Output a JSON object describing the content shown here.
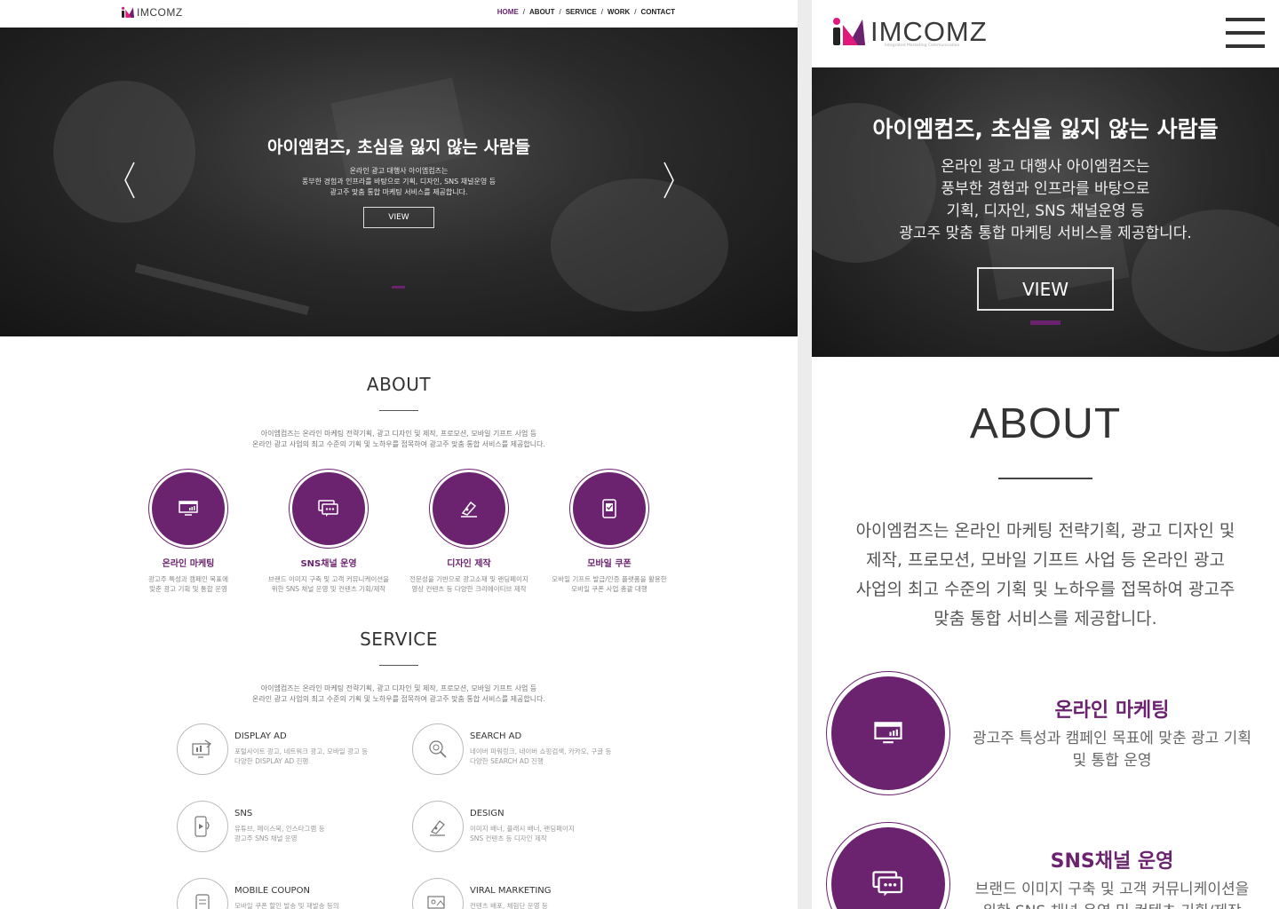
{
  "brand": {
    "name": "IMCOMZ",
    "tagline": "Integrated Marketing Communication",
    "accent": "#6b2370",
    "mark_colors": [
      "#222222",
      "#e0197d",
      "#6b2370"
    ]
  },
  "nav": {
    "items": [
      "HOME",
      "ABOUT",
      "SERVICE",
      "WORK",
      "CONTACT"
    ],
    "separator": "/",
    "active": "HOME"
  },
  "hero": {
    "title": "아이엠컴즈, 초심을 잃지 않는 사람들",
    "desktop_desc": [
      "온라인 광고 대행사 아이엠컴즈는",
      "풍부한 경험과 인프라를 바탕으로 기획, 디자인, SNS 채널운영 등",
      "광고주 맞춤 통합 마케팅 서비스를 제공합니다."
    ],
    "mobile_desc": [
      "온라인 광고 대행사 아이엠컴즈는",
      "풍부한 경험과 인프라를 바탕으로",
      "기획, 디자인, SNS 채널운영 등",
      "광고주 맞춤 통합 마케팅 서비스를 제공합니다."
    ],
    "button": "VIEW",
    "prev_icon": "chevron-left-icon",
    "next_icon": "chevron-right-icon"
  },
  "about": {
    "title": "ABOUT",
    "intro": [
      "아이엠컴즈는 온라인 마케팅 전략기획, 광고 디자인 및 제작, 프로모션, 모바일 기프트 사업 등",
      "온라인 광고 사업의 최고 수준의 기획 및 노하우를 접목하여 광고주 맞춤 통합 서비스를 제공합니다."
    ],
    "mobile_intro": [
      "아이엠컴즈는 온라인 마케팅 전략기획, 광고 디자인 및",
      "제작, 프로모션, 모바일 기프트 사업 등 온라인 광고",
      "사업의 최고 수준의 기획 및 노하우를 접목하여 광고주",
      "맞춤 통합 서비스를 제공합니다."
    ],
    "items": [
      {
        "title": "온라인 마케팅",
        "desc": [
          "광고주 특성과 캠페인 목표에",
          "맞춘 광고 기획 및 통합 운영"
        ],
        "icon": "monitor-chart-icon"
      },
      {
        "title": "SNS채널 운영",
        "desc": [
          "브랜드 이미지 구축 및 고객 커뮤니케이션을",
          "위한 SNS 채널 운영 및 컨텐츠 기획/제작"
        ],
        "icon": "chat-bubble-icon"
      },
      {
        "title": "디자인 제작",
        "desc": [
          "전문성을 기반으로 광고소재 및 랜딩페이지",
          "영상 컨텐츠 등 다양한 크리에이티브 제작"
        ],
        "icon": "pen-tool-icon"
      },
      {
        "title": "모바일 쿠폰",
        "desc": [
          "모바일 기프트 발급/인증 플랫폼을 활용한",
          "모바일 쿠폰 사업 총괄 대행"
        ],
        "icon": "mobile-coupon-icon"
      }
    ],
    "mobile_items": [
      {
        "title": "온라인 마케팅",
        "desc": [
          "광고주 특성과 캠페인 목표에 맞춘 광고 기획",
          "및 통합 운영"
        ]
      },
      {
        "title": "SNS채널 운영",
        "desc": [
          "브랜드 이미지 구축 및 고객 커뮤니케이션을",
          "위한 SNS 채널 운영 및 컨텐츠 기획/제작"
        ]
      }
    ]
  },
  "service": {
    "title": "SERVICE",
    "intro": [
      "아이엠컴즈는 온라인 마케팅 전략기획, 광고 디자인 및 제작, 프로모션, 모바일 기프트 사업 등",
      "온라인 광고 사업의 최고 수준의 기획 및 노하우를 접목하여 광고주 맞춤 통합 서비스를 제공합니다."
    ],
    "items": [
      {
        "title": "DISPLAY AD",
        "desc": [
          "포털사이트 광고, 네트워크 광고, 모바일 광고 등",
          "다양한 DISPLAY AD 진행"
        ],
        "icon": "display-ad-icon"
      },
      {
        "title": "SEARCH AD",
        "desc": [
          "네이버 파워링크, 네이버 쇼핑검색, 카카오, 구글 등",
          "다양한 SEARCH AD 진행"
        ],
        "icon": "search-ad-icon"
      },
      {
        "title": "SNS",
        "desc": [
          "유튜브, 페이스북, 인스타그램 등",
          "광고주 SNS 채널 운영"
        ],
        "icon": "sns-phone-icon"
      },
      {
        "title": "DESIGN",
        "desc": [
          "이미지 배너, 플래시 배너, 랜딩페이지",
          "SNS 컨텐츠 등 디자인 제작"
        ],
        "icon": "design-pen-icon"
      },
      {
        "title": "MOBILE COUPON",
        "desc": [
          "모바일 쿠폰 할인 발송 및 재발송 등의"
        ],
        "icon": "mobile-coupon-icon"
      },
      {
        "title": "VIRAL MARKETING",
        "desc": [
          "컨텐츠 배포, 체험단 운영 등"
        ],
        "icon": "viral-marketing-icon"
      }
    ]
  },
  "menu": {
    "icon": "hamburger-menu-icon"
  }
}
